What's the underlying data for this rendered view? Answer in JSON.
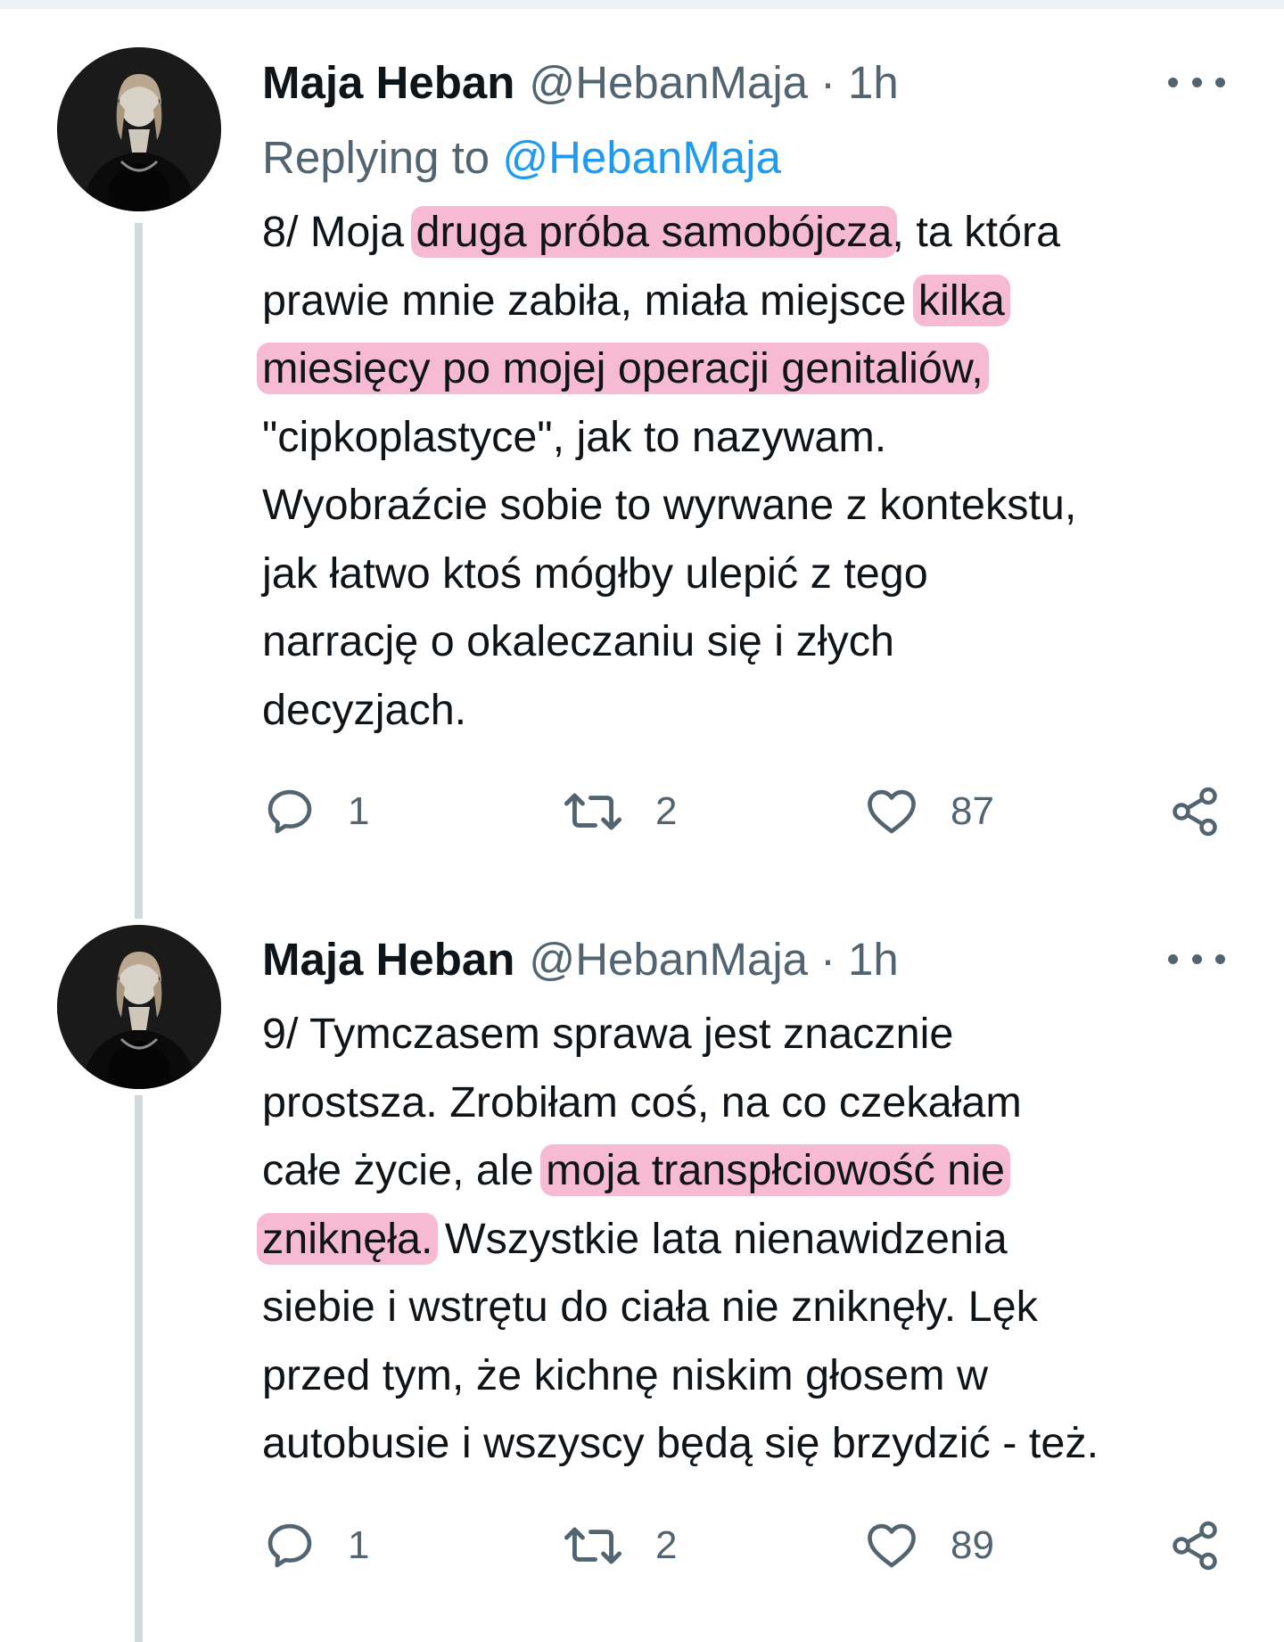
{
  "tweets": [
    {
      "display_name": "Maja Heban",
      "handle": "@HebanMaja",
      "separator": "·",
      "time": "1h",
      "replying_prefix": "Replying to",
      "replying_to": "@HebanMaja",
      "lines": [
        [
          {
            "t": "8/ Moja "
          },
          {
            "t": "druga próba samobójcza",
            "hl": true
          },
          {
            "t": ", ta która"
          }
        ],
        [
          {
            "t": "prawie mnie zabiła, miała miejsce "
          },
          {
            "t": "kilka",
            "hl": true
          }
        ],
        [
          {
            "t": "miesięcy po mojej operacji genitaliów,",
            "hl": true
          }
        ],
        [
          {
            "t": "\"cipkoplastyce\", jak to nazywam."
          }
        ],
        [
          {
            "t": "Wyobraźcie sobie to wyrwane z kontekstu,"
          }
        ],
        [
          {
            "t": "jak łatwo ktoś mógłby ulepić z tego"
          }
        ],
        [
          {
            "t": "narrację o okaleczaniu się i złych"
          }
        ],
        [
          {
            "t": "decyzjach."
          }
        ]
      ],
      "reply_count": "1",
      "retweet_count": "2",
      "like_count": "87"
    },
    {
      "display_name": "Maja Heban",
      "handle": "@HebanMaja",
      "separator": "·",
      "time": "1h",
      "lines": [
        [
          {
            "t": "9/ Tymczasem sprawa jest znacznie"
          }
        ],
        [
          {
            "t": "prostsza. Zrobiłam coś, na co czekałam"
          }
        ],
        [
          {
            "t": "całe życie, ale "
          },
          {
            "t": "moja transpłciowość nie",
            "hl": true
          }
        ],
        [
          {
            "t": "zniknęła.",
            "hl": true
          },
          {
            "t": " Wszystkie lata nienawidzenia"
          }
        ],
        [
          {
            "t": "siebie i wstrętu do ciała nie zniknęły. Lęk"
          }
        ],
        [
          {
            "t": "przed tym, że kichnę niskim głosem w"
          }
        ],
        [
          {
            "t": "autobusie i wszyscy będą się brzydzić - też."
          }
        ]
      ],
      "reply_count": "1",
      "retweet_count": "2",
      "like_count": "89"
    }
  ],
  "icons": {
    "reply": "reply-icon",
    "retweet": "retweet-icon",
    "like": "heart-icon",
    "share": "share-icon",
    "more": "more-options-icon"
  },
  "colors": {
    "text": "#0f1419",
    "secondary": "#536471",
    "link": "#1d9bf0",
    "highlight": "#f082af",
    "thread_line": "#cfd9de"
  }
}
